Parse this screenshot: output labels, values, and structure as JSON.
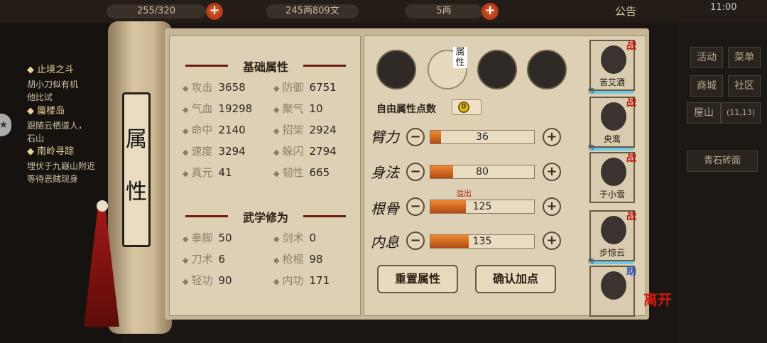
{
  "topbar": {
    "stamina": "255/320",
    "money": "245两809文",
    "gold": "5两",
    "notice": "公告",
    "time": "11:00"
  },
  "quests": [
    {
      "title": "止境之斗",
      "desc": [
        "胡小刀似有机",
        "他比试"
      ]
    },
    {
      "title": "蜃楼岛",
      "desc": [
        "跟随云栖道人，",
        "石山"
      ]
    },
    {
      "title": "南岭寻踪",
      "desc": [
        "埋伏于九嶷山附近",
        "等待恶贼现身"
      ]
    }
  ],
  "right_menu": {
    "items": [
      "活动",
      "菜单",
      "商城",
      "社区"
    ],
    "location": "屋山",
    "coords": "(11,13)",
    "tile": "青石砖面"
  },
  "scroll": {
    "title_top": "属",
    "title_bottom": "性"
  },
  "basic": {
    "title": "基础属性",
    "stats": [
      {
        "label": "攻击",
        "value": "3658"
      },
      {
        "label": "防御",
        "value": "6751"
      },
      {
        "label": "气血",
        "value": "19298"
      },
      {
        "label": "聚气",
        "value": "10"
      },
      {
        "label": "命中",
        "value": "2140"
      },
      {
        "label": "招架",
        "value": "2924"
      },
      {
        "label": "速度",
        "value": "3294"
      },
      {
        "label": "躲闪",
        "value": "2794"
      },
      {
        "label": "真元",
        "value": "41"
      },
      {
        "label": "韧性",
        "value": "665"
      }
    ]
  },
  "martial": {
    "title": "武学修为",
    "stats": [
      {
        "label": "拳脚",
        "value": "50"
      },
      {
        "label": "剑术",
        "value": "0"
      },
      {
        "label": "刀术",
        "value": "6"
      },
      {
        "label": "枪棍",
        "value": "98"
      },
      {
        "label": "轻功",
        "value": "90"
      },
      {
        "label": "内功",
        "value": "171"
      }
    ]
  },
  "tab_label": "属性",
  "free_points": {
    "label": "自由属性点数",
    "value": "0"
  },
  "attrs": [
    {
      "name": "臂力",
      "value": "36",
      "fill": 0.1
    },
    {
      "name": "身法",
      "value": "80",
      "fill": 0.22
    },
    {
      "name": "根骨",
      "value": "125",
      "fill": 0.34
    },
    {
      "name": "内息",
      "value": "135",
      "fill": 0.37
    }
  ],
  "overflow_label": "溢出",
  "buttons": {
    "reset": "重置属性",
    "confirm": "确认加点"
  },
  "party": [
    {
      "name": "苦艾酒",
      "tag": "战"
    },
    {
      "name": "央鸾",
      "tag": "战"
    },
    {
      "name": "于小雪",
      "tag": "战"
    },
    {
      "name": "步惊云",
      "tag": "战"
    },
    {
      "name": "",
      "tag": "助"
    }
  ],
  "leave": "离开",
  "colors": {
    "accent_red": "#c0140e",
    "bar_orange": "#e07528",
    "paper": "#ddd0b4"
  }
}
